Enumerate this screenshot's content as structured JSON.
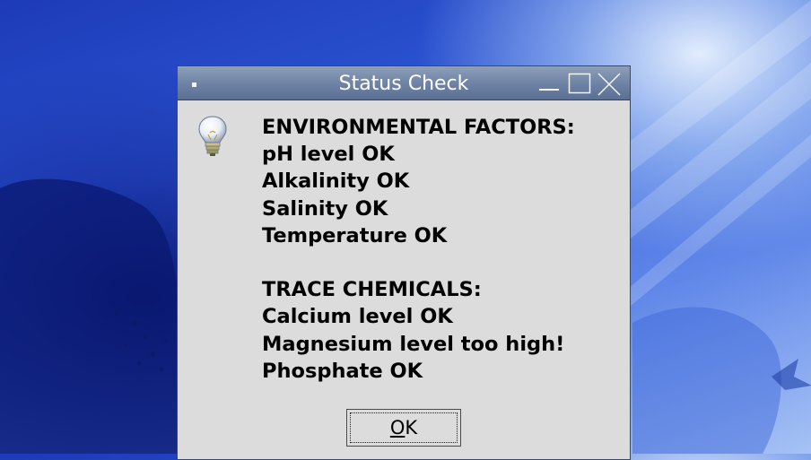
{
  "window": {
    "title": "Status Check",
    "controls": [
      "minimize-icon",
      "maximize-icon",
      "close-icon"
    ]
  },
  "message": {
    "icon": "lightbulb-icon",
    "lines": [
      "ENVIRONMENTAL FACTORS:",
      "pH level OK",
      "Alkalinity OK",
      "Salinity OK",
      "Temperature OK",
      "",
      "TRACE CHEMICALS:",
      "Calcium level OK",
      "Magnesium level too high!",
      "Phosphate OK"
    ]
  },
  "buttons": {
    "ok_mnemonic": "O",
    "ok_rest": "K"
  },
  "colors": {
    "titlebar": "#6f84a6",
    "dialog_bg": "#dcdcdc",
    "desktop": "#2c55d4"
  }
}
